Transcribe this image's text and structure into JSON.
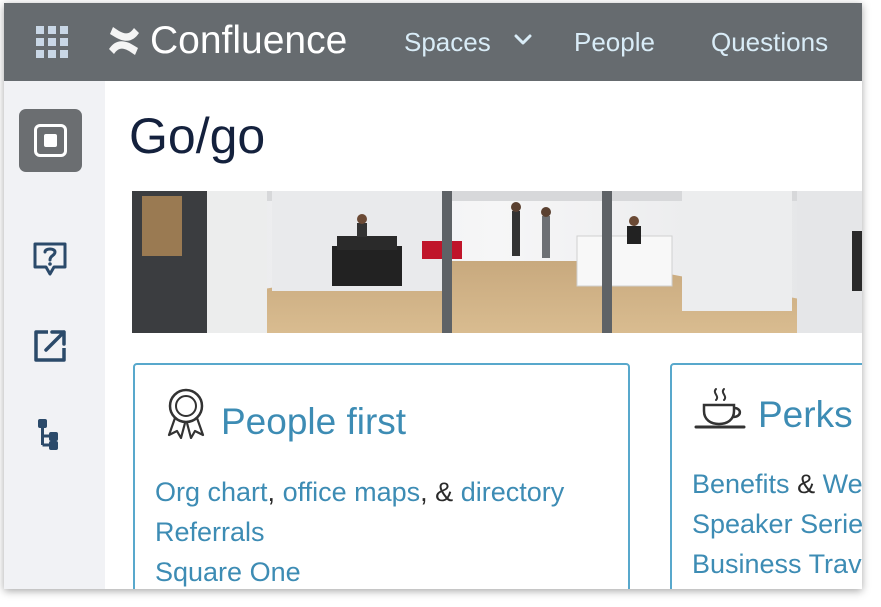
{
  "header": {
    "logo_text": "Confluence",
    "nav": {
      "spaces": "Spaces",
      "people": "People",
      "questions": "Questions"
    }
  },
  "page": {
    "title": "Go/go"
  },
  "cards": {
    "people_first": {
      "title": "People first",
      "line1": {
        "org_chart": "Org chart",
        "comma1": ",",
        "office_maps": "office maps",
        "comma_amp": ", &",
        "directory": "directory"
      },
      "referrals": "Referrals",
      "square_one": "Square One"
    },
    "perks": {
      "title": "Perks",
      "line1": {
        "benefits": "Benefits",
        "amp": "&",
        "partial": "We"
      },
      "speaker_series": "Speaker Serie",
      "business_travel": "Business Trav"
    }
  },
  "colors": {
    "topbar": "#666b6f",
    "nav_text": "#d9ecf7",
    "sidebar": "#f1f2f5",
    "link": "#3d8cb4",
    "card_border": "#58a8cc",
    "title": "#14213d"
  },
  "icons": {
    "apps": "app-switcher-grid-icon",
    "logo": "confluence-logo-icon",
    "spaces_dropdown": "chevron-down-icon",
    "space_avatar": "square-space-icon",
    "help": "question-bubble-icon",
    "external": "external-link-icon",
    "tree": "page-tree-icon",
    "people_first": "award-ribbon-icon",
    "perks": "coffee-cup-icon"
  }
}
